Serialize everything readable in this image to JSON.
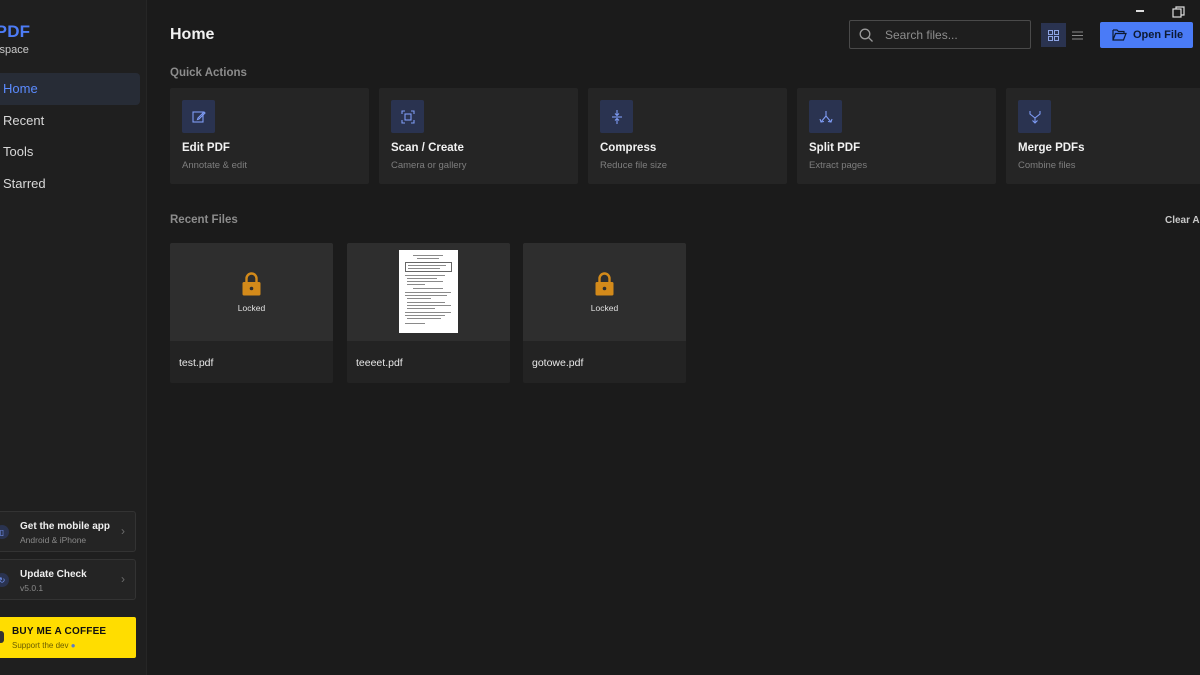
{
  "app": {
    "brand": "vPDF",
    "brand_sub": "kspace"
  },
  "nav": [
    {
      "label": "Home",
      "active": true
    },
    {
      "label": "Recent",
      "active": false
    },
    {
      "label": "Tools",
      "active": false
    },
    {
      "label": "Starred",
      "active": false
    }
  ],
  "promos": [
    {
      "title": "Get the mobile app",
      "sub": "Android & iPhone",
      "icon": "phone-icon"
    },
    {
      "title": "Update Check",
      "sub": "v5.0.1",
      "icon": "refresh-icon"
    }
  ],
  "coffee": {
    "title": "BUY ME A COFFEE",
    "sub": "Support the dev"
  },
  "header": {
    "title": "Home",
    "search_placeholder": "Search files...",
    "open_label": "Open File"
  },
  "quick_actions": {
    "title": "Quick Actions",
    "items": [
      {
        "title": "Edit PDF",
        "sub": "Annotate & edit",
        "icon": "edit-icon"
      },
      {
        "title": "Scan / Create",
        "sub": "Camera or gallery",
        "icon": "scan-icon"
      },
      {
        "title": "Compress",
        "sub": "Reduce file size",
        "icon": "compress-icon"
      },
      {
        "title": "Split PDF",
        "sub": "Extract pages",
        "icon": "split-icon"
      },
      {
        "title": "Merge PDFs",
        "sub": "Combine files",
        "icon": "merge-icon"
      }
    ]
  },
  "recent": {
    "title": "Recent Files",
    "clear_label": "Clear A",
    "files": [
      {
        "name": "test.pdf",
        "locked": true,
        "lock_label": "Locked"
      },
      {
        "name": "teeeet.pdf",
        "locked": false
      },
      {
        "name": "gotowe.pdf",
        "locked": true,
        "lock_label": "Locked"
      }
    ]
  },
  "colors": {
    "accent": "#4a7bf7",
    "lock": "#d38a1a",
    "coffee": "#ffdd00"
  }
}
